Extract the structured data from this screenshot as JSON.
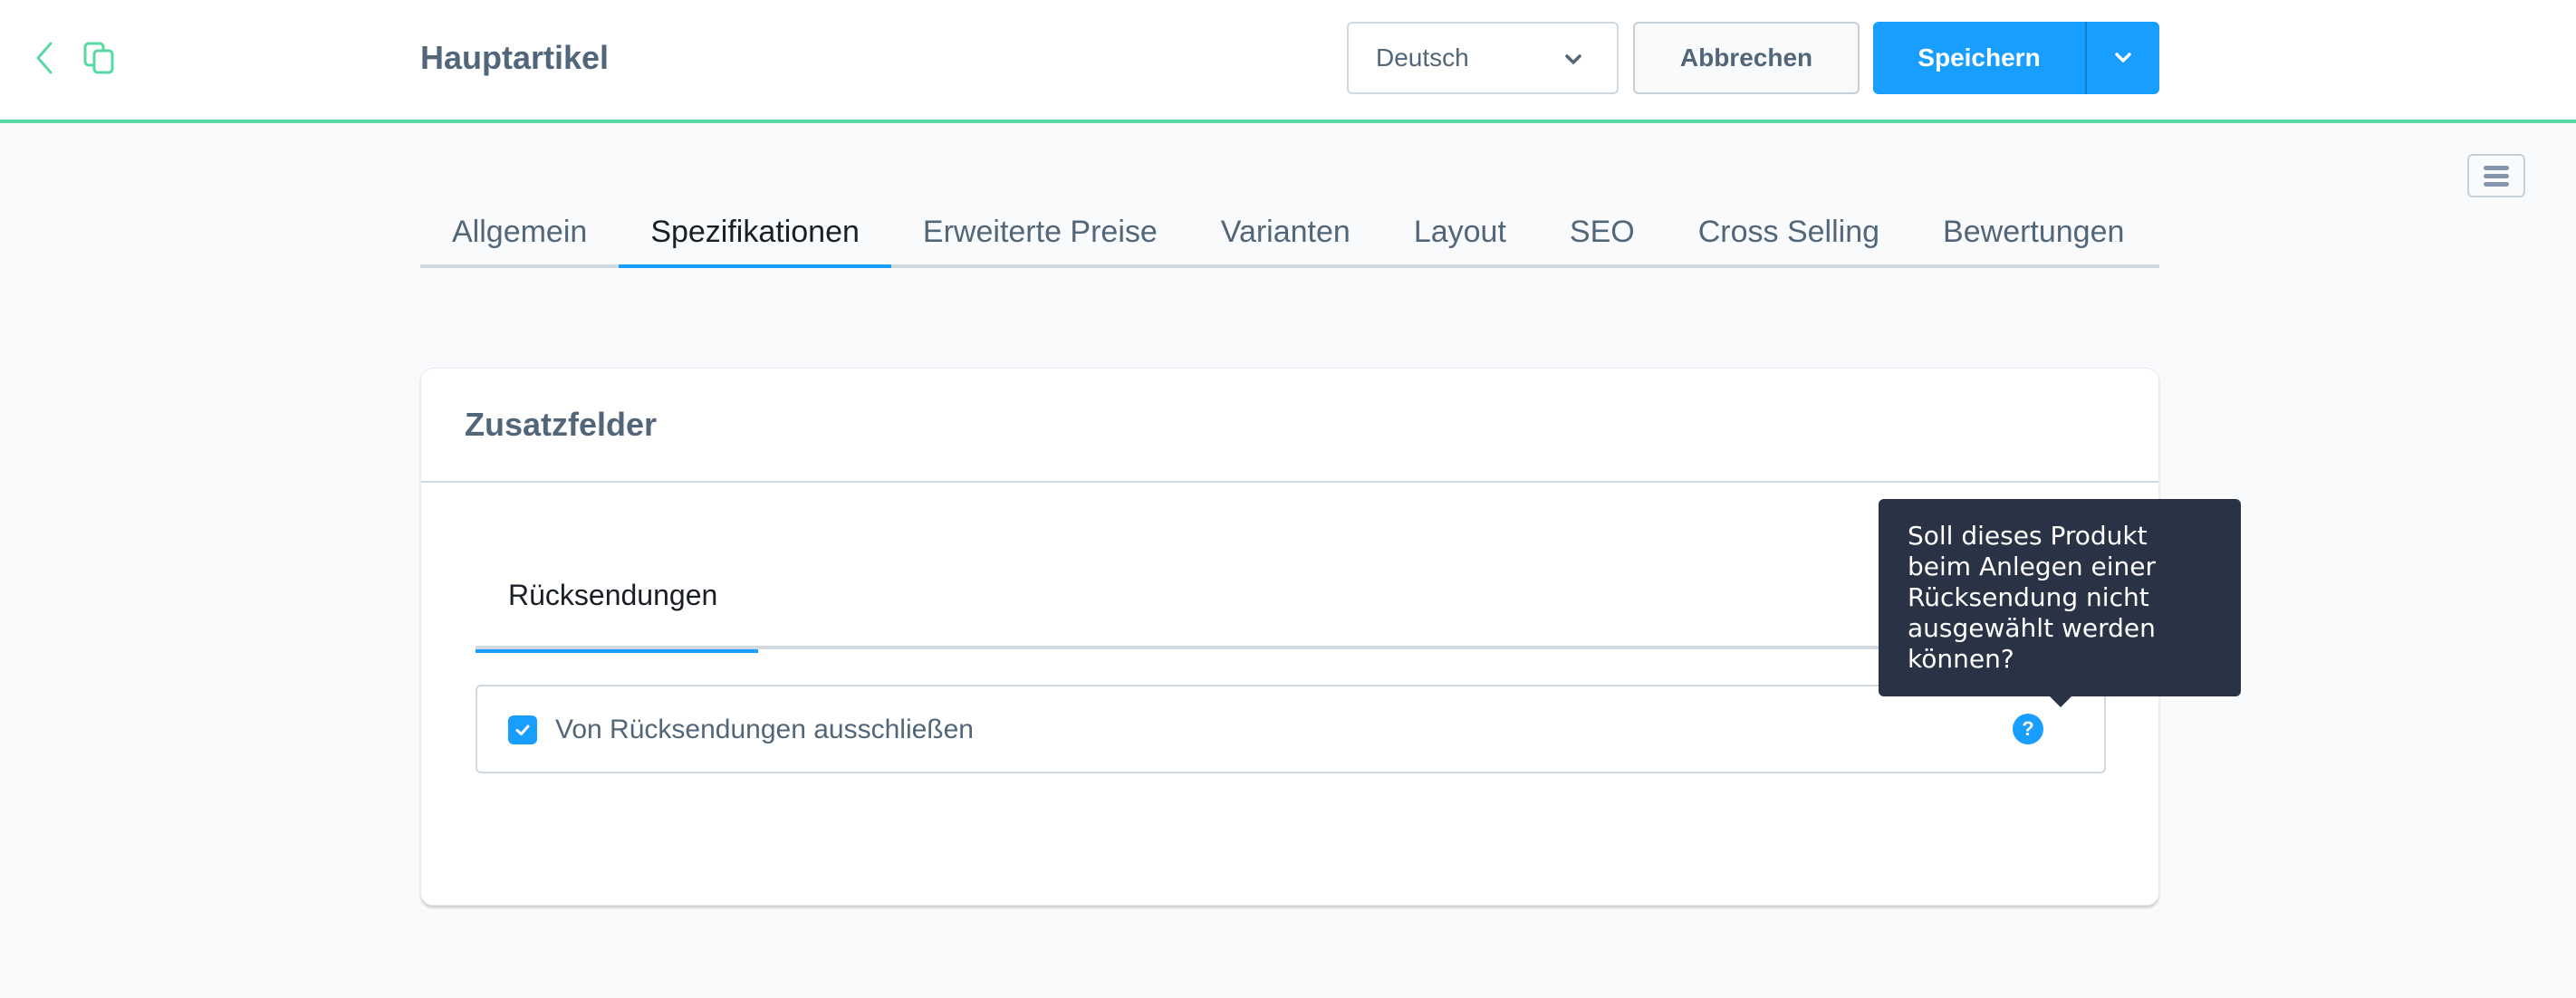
{
  "header": {
    "title": "Hauptartikel",
    "back_icon": "chevron-left-icon",
    "duplicate_icon": "duplicate-icon",
    "language_select": {
      "value": "Deutsch"
    },
    "cancel_label": "Abbrechen",
    "save_label": "Speichern",
    "accent_color": "#57d9a3"
  },
  "tabs": [
    {
      "label": "Allgemein",
      "active": false
    },
    {
      "label": "Spezifikationen",
      "active": true
    },
    {
      "label": "Erweiterte Preise",
      "active": false
    },
    {
      "label": "Varianten",
      "active": false
    },
    {
      "label": "Layout",
      "active": false
    },
    {
      "label": "SEO",
      "active": false
    },
    {
      "label": "Cross Selling",
      "active": false
    },
    {
      "label": "Bewertungen",
      "active": false
    }
  ],
  "card": {
    "title": "Zusatzfelder",
    "inner_tabs": [
      {
        "label": "Rücksendungen",
        "active": true
      }
    ],
    "fields": [
      {
        "label": "Von Rücksendungen ausschließen",
        "checked": true,
        "help_tooltip": "Soll dieses Produkt beim Anlegen einer Rücksendung nicht ausgewählt werden können?"
      }
    ]
  },
  "colors": {
    "primary": "#189eff",
    "tooltip_bg": "#2a3345",
    "text": "#52667a"
  }
}
